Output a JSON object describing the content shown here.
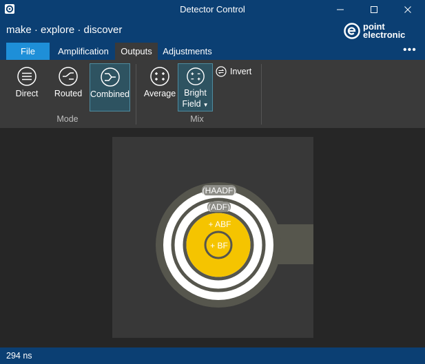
{
  "window": {
    "title": "Detector Control"
  },
  "header": {
    "tagline": "make · explore · discover",
    "brand_line1": "point",
    "brand_line2": "electronic"
  },
  "tabs": {
    "file": "File",
    "amplification": "Amplification",
    "outputs": "Outputs",
    "adjustments": "Adjustments",
    "more": "•••"
  },
  "ribbon": {
    "mode": {
      "label": "Mode",
      "buttons": [
        {
          "label": "Direct",
          "icon": "direct-icon"
        },
        {
          "label": "Routed",
          "icon": "routed-icon"
        },
        {
          "label": "Combined",
          "icon": "combined-icon",
          "selected": true
        }
      ]
    },
    "mix": {
      "label": "Mix",
      "average": "Average",
      "bright_line1": "Bright",
      "bright_line2": "Field",
      "invert": "Invert"
    }
  },
  "detector": {
    "rings": [
      {
        "label": "(HAADF)"
      },
      {
        "label": "(ADF)"
      },
      {
        "label": "+ ABF"
      },
      {
        "label": "+ BF"
      }
    ],
    "colors": {
      "active": "#f5c400",
      "inactive": "#ffffff",
      "ring": "#56564d",
      "panel": "#383838"
    }
  },
  "status": {
    "timing": "294 ns"
  },
  "colors": {
    "titlebar": "#0b3f73",
    "accent": "#1e8fd8",
    "ribbon": "#3a3a3a",
    "selected": "#2e5361"
  }
}
